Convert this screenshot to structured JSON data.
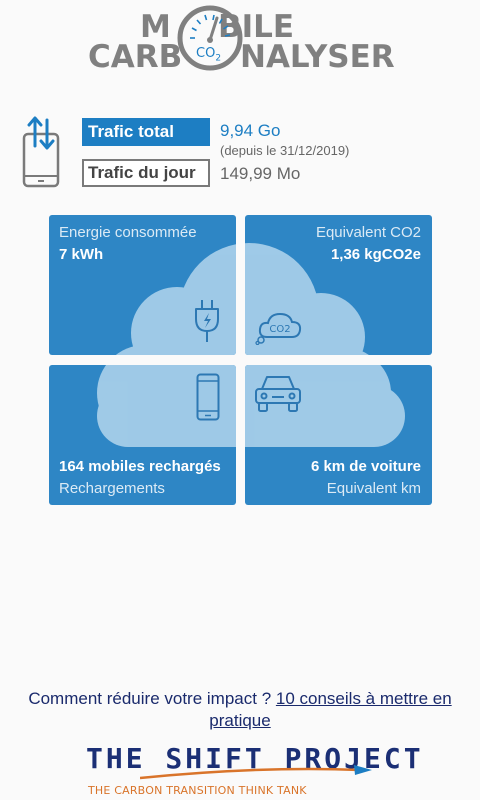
{
  "logo": {
    "word1a": "M",
    "word1b": "BILE",
    "word2a": "CARB",
    "word2b": "NALYSER",
    "co2": "CO",
    "co2_sub": "2"
  },
  "traffic": {
    "total_label": "Trafic total",
    "total_value": "9,94 Go",
    "since": "(depuis le 31/12/2019)",
    "day_label": "Trafic du jour",
    "day_value": "149,99 Mo"
  },
  "tiles": {
    "energy": {
      "label": "Energie consommée",
      "value": "7 kWh",
      "icon": "plug-icon"
    },
    "co2": {
      "label": "Equivalent CO2",
      "value": "1,36 kgCO2e",
      "icon": "co2-cloud-icon",
      "icon_text": "CO2"
    },
    "mobiles": {
      "value": "164 mobiles rechargés",
      "label": "Rechargements",
      "icon": "smartphone-icon"
    },
    "car": {
      "value": "6 km de voiture",
      "label": "Equivalent km",
      "icon": "car-icon"
    }
  },
  "footer": {
    "tips_prefix": "Comment réduire votre impact ?",
    "tips_link": "10 conseils à mettre en pratique",
    "brand": "THE SHIFT PROJECT",
    "tagline": "THE CARBON TRANSITION THINK TANK"
  },
  "colors": {
    "accent": "#1d7ec3",
    "tile": "#2e86c5",
    "brand_navy": "#1b2f75",
    "tagline_orange": "#d9742a"
  }
}
